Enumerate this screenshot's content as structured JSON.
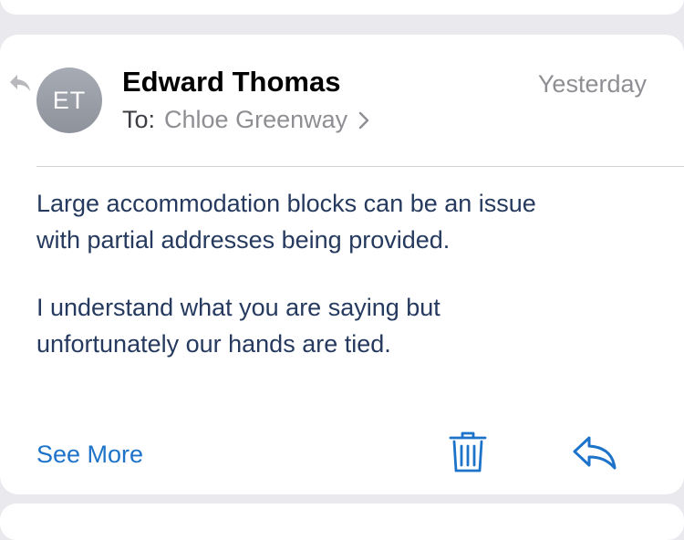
{
  "message": {
    "avatar_initials": "ET",
    "sender_name": "Edward Thomas",
    "date": "Yesterday",
    "to_label": "To:",
    "recipient": "Chloe Greenway",
    "paragraphs": [
      "Large accommodation blocks can be an issue\nwith partial addresses being provided.",
      "I understand what you are saying but\nunfortunately our hands are tied."
    ]
  },
  "actions": {
    "see_more_label": "See More",
    "trash_icon": "trash-icon",
    "reply_icon": "reply-icon"
  },
  "colors": {
    "accent": "#1d73c9",
    "body_text": "#253a5e",
    "secondary_text": "#8e8e93",
    "avatar_bg": "#9a9ea7",
    "background": "#e9e9ee"
  }
}
